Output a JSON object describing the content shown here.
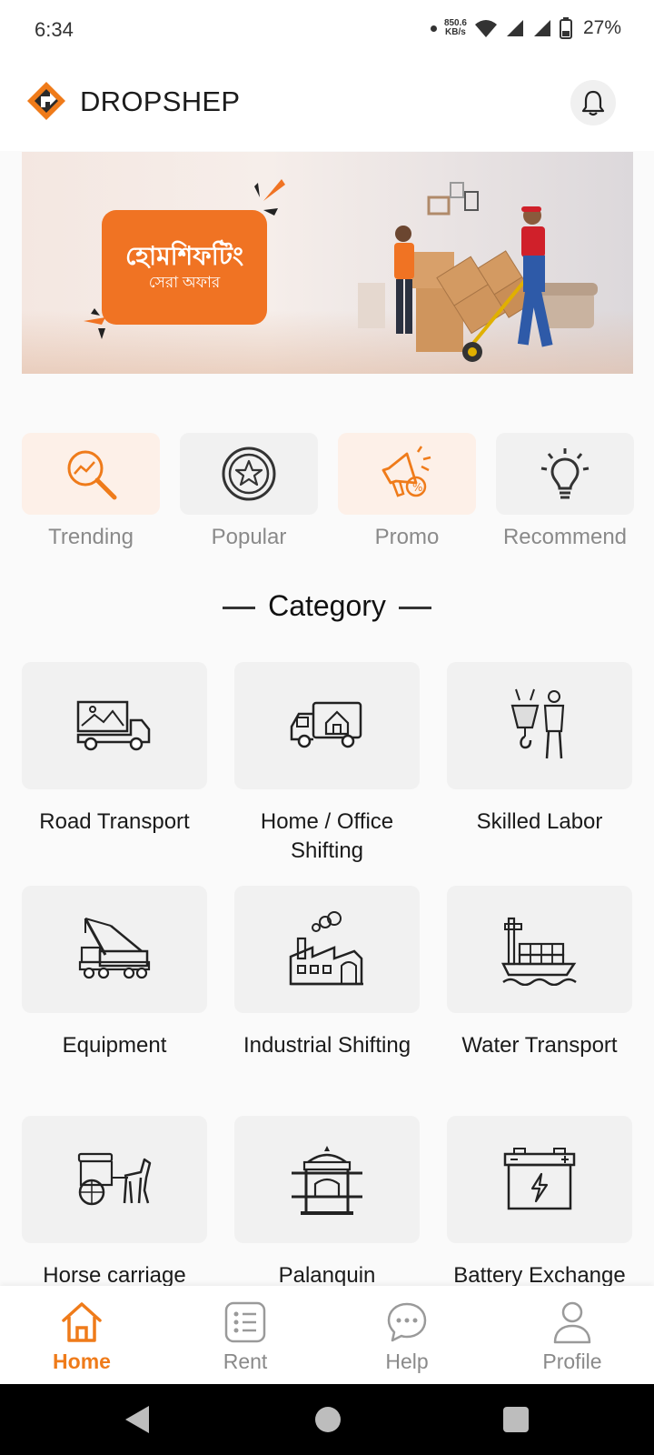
{
  "status_bar": {
    "time": "6:34",
    "net_speed_value": "850.6",
    "net_speed_unit": "KB/s",
    "battery": "27%"
  },
  "header": {
    "brand": "DROPSHEP",
    "logo_icon": "dropshep-logo-icon",
    "bell_icon": "bell-icon"
  },
  "banner": {
    "title": "হোমশিফটিং",
    "subtitle": "সেরা অফার"
  },
  "quick_links": [
    {
      "label": "Trending",
      "icon": "trending-search-icon"
    },
    {
      "label": "Popular",
      "icon": "star-badge-icon"
    },
    {
      "label": "Promo",
      "icon": "megaphone-icon"
    },
    {
      "label": "Recommend",
      "icon": "lightbulb-icon"
    }
  ],
  "category": {
    "heading": "Category",
    "items": [
      {
        "label": "Road Transport",
        "icon": "truck-icon"
      },
      {
        "label": "Home / Office Shifting",
        "icon": "moving-van-icon"
      },
      {
        "label": "Skilled Labor",
        "icon": "worker-hook-icon"
      },
      {
        "label": "Equipment",
        "icon": "crane-truck-icon"
      },
      {
        "label": "Industrial Shifting",
        "icon": "factory-icon"
      },
      {
        "label": "Water Transport",
        "icon": "cargo-ship-icon"
      },
      {
        "label": "Horse carriage",
        "icon": "horse-carriage-icon"
      },
      {
        "label": "Palanquin",
        "icon": "palanquin-icon"
      },
      {
        "label": "Battery Exchange",
        "icon": "battery-icon"
      }
    ]
  },
  "bottom_nav": {
    "items": [
      {
        "label": "Home",
        "icon": "home-icon",
        "active": true
      },
      {
        "label": "Rent",
        "icon": "list-icon",
        "active": false
      },
      {
        "label": "Help",
        "icon": "chat-bubble-icon",
        "active": false
      },
      {
        "label": "Profile",
        "icon": "user-icon",
        "active": false
      }
    ]
  },
  "colors": {
    "accent": "#ef7b1a",
    "tile_orange_bg": "#fdf0e8",
    "tile_gray_bg": "#f1f1f1",
    "muted_text": "#8a8a8a"
  }
}
